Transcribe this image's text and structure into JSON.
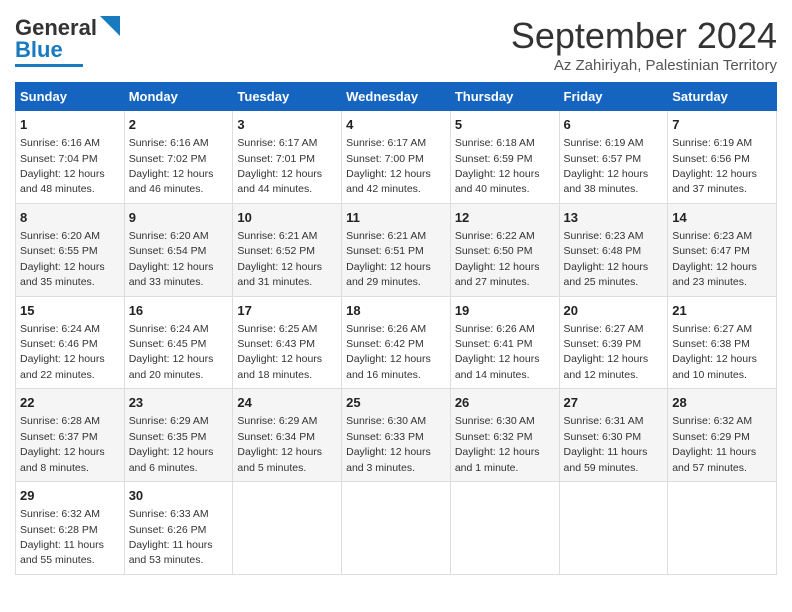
{
  "logo": {
    "line1": "General",
    "line2": "Blue"
  },
  "title": "September 2024",
  "location": "Az Zahiriyah, Palestinian Territory",
  "days_of_week": [
    "Sunday",
    "Monday",
    "Tuesday",
    "Wednesday",
    "Thursday",
    "Friday",
    "Saturday"
  ],
  "weeks": [
    [
      {
        "day": "1",
        "sunrise": "Sunrise: 6:16 AM",
        "sunset": "Sunset: 7:04 PM",
        "daylight": "Daylight: 12 hours and 48 minutes."
      },
      {
        "day": "2",
        "sunrise": "Sunrise: 6:16 AM",
        "sunset": "Sunset: 7:02 PM",
        "daylight": "Daylight: 12 hours and 46 minutes."
      },
      {
        "day": "3",
        "sunrise": "Sunrise: 6:17 AM",
        "sunset": "Sunset: 7:01 PM",
        "daylight": "Daylight: 12 hours and 44 minutes."
      },
      {
        "day": "4",
        "sunrise": "Sunrise: 6:17 AM",
        "sunset": "Sunset: 7:00 PM",
        "daylight": "Daylight: 12 hours and 42 minutes."
      },
      {
        "day": "5",
        "sunrise": "Sunrise: 6:18 AM",
        "sunset": "Sunset: 6:59 PM",
        "daylight": "Daylight: 12 hours and 40 minutes."
      },
      {
        "day": "6",
        "sunrise": "Sunrise: 6:19 AM",
        "sunset": "Sunset: 6:57 PM",
        "daylight": "Daylight: 12 hours and 38 minutes."
      },
      {
        "day": "7",
        "sunrise": "Sunrise: 6:19 AM",
        "sunset": "Sunset: 6:56 PM",
        "daylight": "Daylight: 12 hours and 37 minutes."
      }
    ],
    [
      {
        "day": "8",
        "sunrise": "Sunrise: 6:20 AM",
        "sunset": "Sunset: 6:55 PM",
        "daylight": "Daylight: 12 hours and 35 minutes."
      },
      {
        "day": "9",
        "sunrise": "Sunrise: 6:20 AM",
        "sunset": "Sunset: 6:54 PM",
        "daylight": "Daylight: 12 hours and 33 minutes."
      },
      {
        "day": "10",
        "sunrise": "Sunrise: 6:21 AM",
        "sunset": "Sunset: 6:52 PM",
        "daylight": "Daylight: 12 hours and 31 minutes."
      },
      {
        "day": "11",
        "sunrise": "Sunrise: 6:21 AM",
        "sunset": "Sunset: 6:51 PM",
        "daylight": "Daylight: 12 hours and 29 minutes."
      },
      {
        "day": "12",
        "sunrise": "Sunrise: 6:22 AM",
        "sunset": "Sunset: 6:50 PM",
        "daylight": "Daylight: 12 hours and 27 minutes."
      },
      {
        "day": "13",
        "sunrise": "Sunrise: 6:23 AM",
        "sunset": "Sunset: 6:48 PM",
        "daylight": "Daylight: 12 hours and 25 minutes."
      },
      {
        "day": "14",
        "sunrise": "Sunrise: 6:23 AM",
        "sunset": "Sunset: 6:47 PM",
        "daylight": "Daylight: 12 hours and 23 minutes."
      }
    ],
    [
      {
        "day": "15",
        "sunrise": "Sunrise: 6:24 AM",
        "sunset": "Sunset: 6:46 PM",
        "daylight": "Daylight: 12 hours and 22 minutes."
      },
      {
        "day": "16",
        "sunrise": "Sunrise: 6:24 AM",
        "sunset": "Sunset: 6:45 PM",
        "daylight": "Daylight: 12 hours and 20 minutes."
      },
      {
        "day": "17",
        "sunrise": "Sunrise: 6:25 AM",
        "sunset": "Sunset: 6:43 PM",
        "daylight": "Daylight: 12 hours and 18 minutes."
      },
      {
        "day": "18",
        "sunrise": "Sunrise: 6:26 AM",
        "sunset": "Sunset: 6:42 PM",
        "daylight": "Daylight: 12 hours and 16 minutes."
      },
      {
        "day": "19",
        "sunrise": "Sunrise: 6:26 AM",
        "sunset": "Sunset: 6:41 PM",
        "daylight": "Daylight: 12 hours and 14 minutes."
      },
      {
        "day": "20",
        "sunrise": "Sunrise: 6:27 AM",
        "sunset": "Sunset: 6:39 PM",
        "daylight": "Daylight: 12 hours and 12 minutes."
      },
      {
        "day": "21",
        "sunrise": "Sunrise: 6:27 AM",
        "sunset": "Sunset: 6:38 PM",
        "daylight": "Daylight: 12 hours and 10 minutes."
      }
    ],
    [
      {
        "day": "22",
        "sunrise": "Sunrise: 6:28 AM",
        "sunset": "Sunset: 6:37 PM",
        "daylight": "Daylight: 12 hours and 8 minutes."
      },
      {
        "day": "23",
        "sunrise": "Sunrise: 6:29 AM",
        "sunset": "Sunset: 6:35 PM",
        "daylight": "Daylight: 12 hours and 6 minutes."
      },
      {
        "day": "24",
        "sunrise": "Sunrise: 6:29 AM",
        "sunset": "Sunset: 6:34 PM",
        "daylight": "Daylight: 12 hours and 5 minutes."
      },
      {
        "day": "25",
        "sunrise": "Sunrise: 6:30 AM",
        "sunset": "Sunset: 6:33 PM",
        "daylight": "Daylight: 12 hours and 3 minutes."
      },
      {
        "day": "26",
        "sunrise": "Sunrise: 6:30 AM",
        "sunset": "Sunset: 6:32 PM",
        "daylight": "Daylight: 12 hours and 1 minute."
      },
      {
        "day": "27",
        "sunrise": "Sunrise: 6:31 AM",
        "sunset": "Sunset: 6:30 PM",
        "daylight": "Daylight: 11 hours and 59 minutes."
      },
      {
        "day": "28",
        "sunrise": "Sunrise: 6:32 AM",
        "sunset": "Sunset: 6:29 PM",
        "daylight": "Daylight: 11 hours and 57 minutes."
      }
    ],
    [
      {
        "day": "29",
        "sunrise": "Sunrise: 6:32 AM",
        "sunset": "Sunset: 6:28 PM",
        "daylight": "Daylight: 11 hours and 55 minutes."
      },
      {
        "day": "30",
        "sunrise": "Sunrise: 6:33 AM",
        "sunset": "Sunset: 6:26 PM",
        "daylight": "Daylight: 11 hours and 53 minutes."
      },
      null,
      null,
      null,
      null,
      null
    ]
  ]
}
